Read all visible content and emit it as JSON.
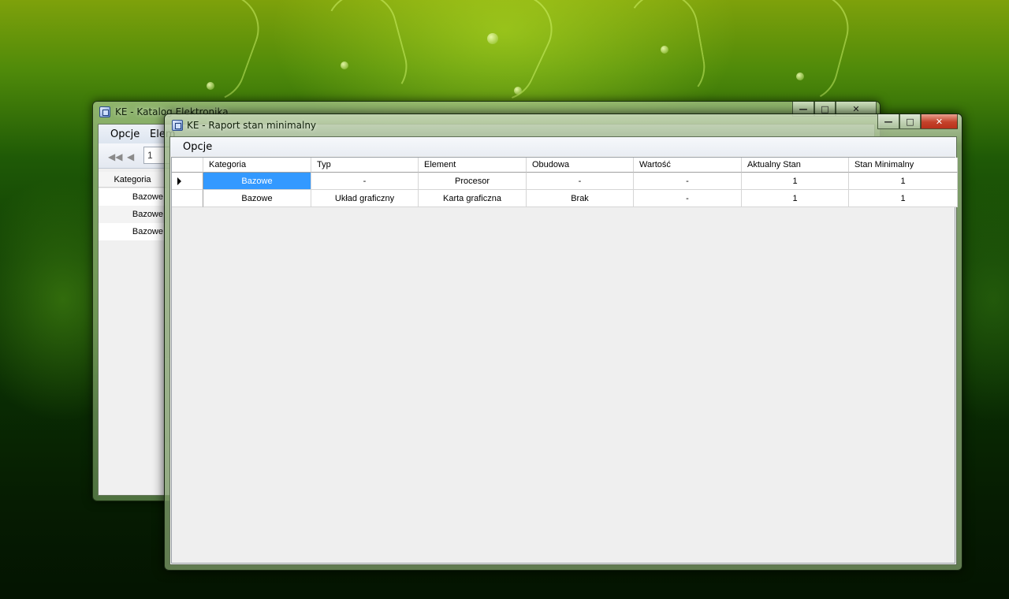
{
  "back_window": {
    "title": "KE - Katalog Elektronika",
    "menu": [
      "Opcje",
      "Elem"
    ],
    "page_input_value": "1",
    "grid": {
      "header": "Kategoria",
      "rows": [
        "Bazowe",
        "Bazowe",
        "Bazowe"
      ]
    }
  },
  "front_window": {
    "title": "KE - Raport stan minimalny",
    "menu": {
      "opcje": "Opcje"
    },
    "grid": {
      "columns": [
        "Kategoria",
        "Typ",
        "Element",
        "Obudowa",
        "Wartość",
        "Aktualny Stan",
        "Stan Minimalny"
      ],
      "rows": [
        [
          "Bazowe",
          "-",
          "Procesor",
          "-",
          "-",
          "1",
          "1"
        ],
        [
          "Bazowe",
          "Układ graficzny",
          "Karta graficzna",
          "Brak",
          "-",
          "1",
          "1"
        ]
      ],
      "selected_cell": {
        "row": 0,
        "column": 0
      }
    },
    "selection_color": "#3399ff"
  },
  "caption_buttons": {
    "minimize_icon": "minimize-icon",
    "maximize_icon": "maximize-icon",
    "close_icon": "close-icon",
    "close_color": "#c4412a"
  }
}
